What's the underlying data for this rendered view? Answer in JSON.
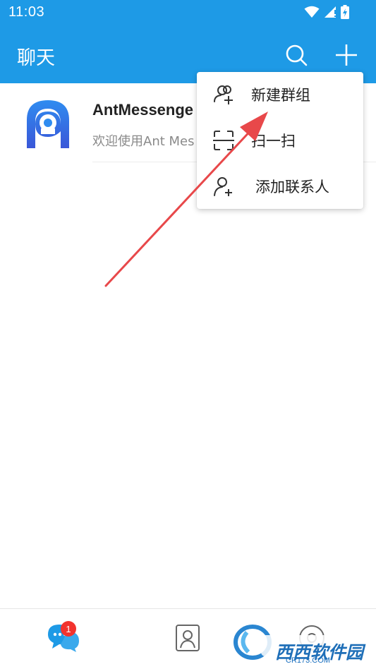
{
  "status_bar": {
    "time": "11:03",
    "icons": [
      "wifi-icon",
      "signal-icon",
      "battery-charging-icon"
    ]
  },
  "app_bar": {
    "title": "聊天",
    "actions": [
      "search-icon",
      "plus-icon"
    ],
    "color": "#1e9ae6"
  },
  "conversations": [
    {
      "name": "AntMessenge",
      "preview": "欢迎使用Ant Mes",
      "avatar": "ant-messenger-logo"
    }
  ],
  "popup_menu": {
    "items": [
      {
        "label": "新建群组",
        "icon": "group-add-icon"
      },
      {
        "label": "扫一扫",
        "icon": "scan-icon"
      },
      {
        "label": "添加联系人",
        "icon": "person-add-icon"
      }
    ]
  },
  "bottom_nav": {
    "items": [
      {
        "icon": "chat-icon",
        "badge": "1",
        "active": true
      },
      {
        "icon": "contacts-icon",
        "active": false
      },
      {
        "icon": "discover-icon",
        "active": false
      }
    ],
    "active_color": "#1e9ae6",
    "badge_color": "#f2332e"
  },
  "watermark": {
    "text": "西西软件园",
    "sub": "CR173.COM",
    "logo_letters": "Cr"
  },
  "annotation": {
    "color": "#e8484a"
  }
}
